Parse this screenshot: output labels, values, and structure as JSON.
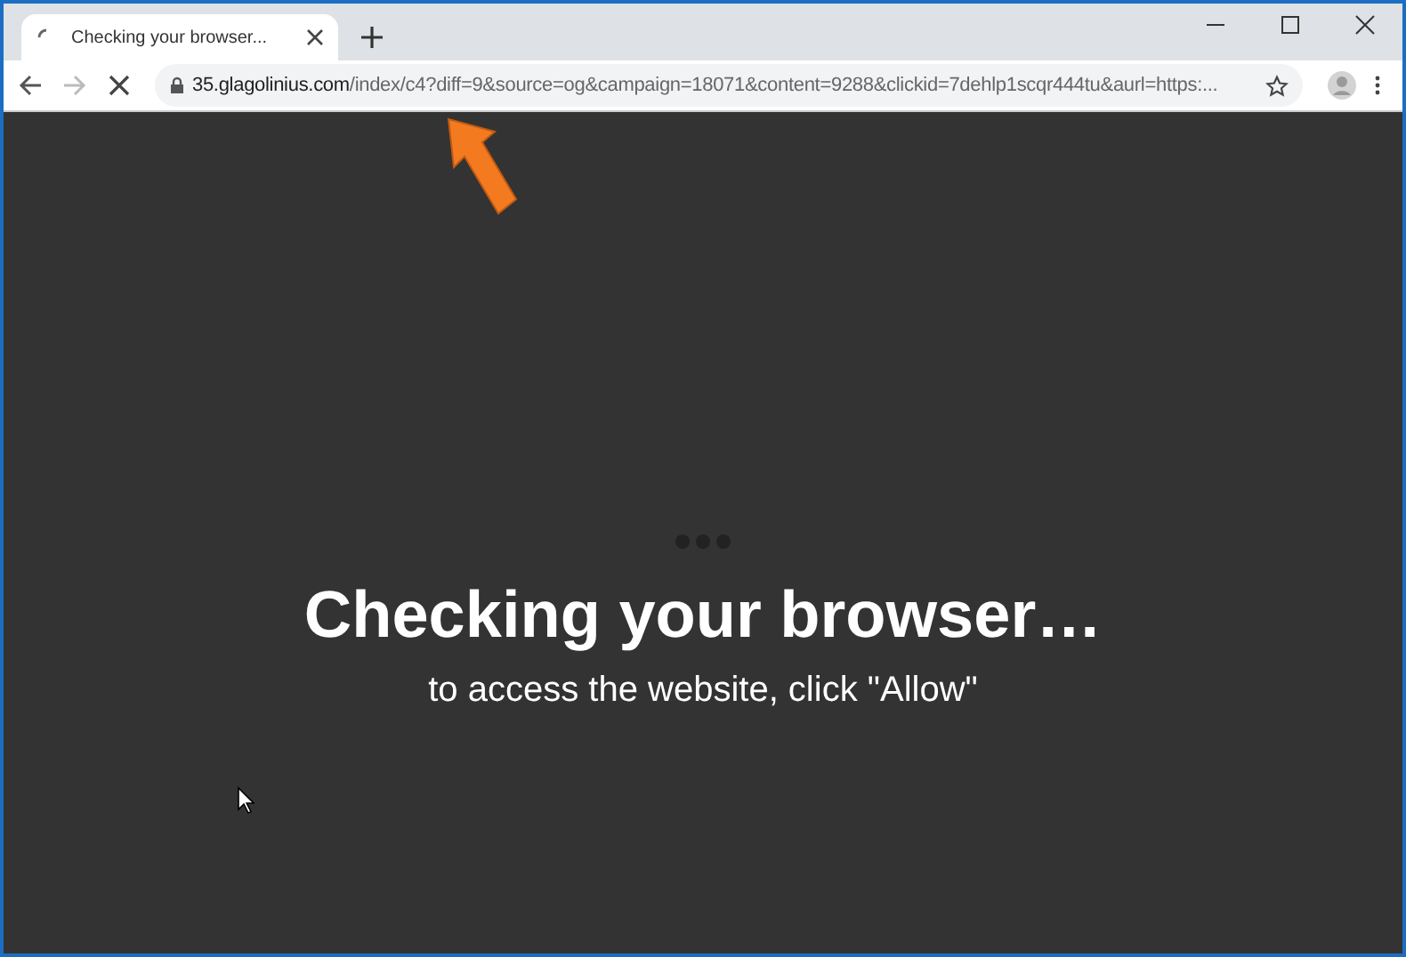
{
  "tab": {
    "title": "Checking your browser...",
    "loading": true
  },
  "address_bar": {
    "host": "35.glagolinius.com",
    "path": "/index/c4?diff=9&source=og&campaign=18071&content=9288&clickid=7dehlp1scqr444tu&aurl=https:..."
  },
  "page": {
    "heading": "Checking your browser…",
    "subtext": "to access the website, click \"Allow\""
  }
}
